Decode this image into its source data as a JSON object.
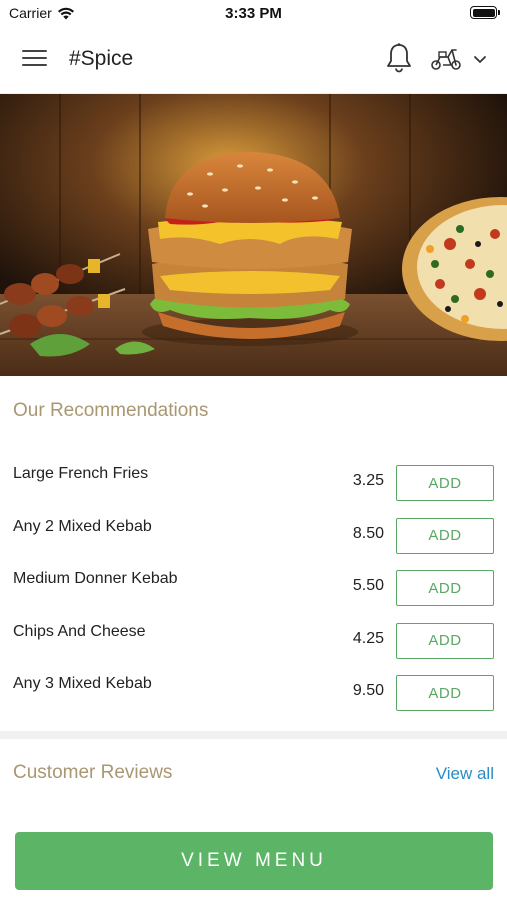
{
  "status_bar": {
    "carrier": "Carrier",
    "time": "3:33 PM"
  },
  "header": {
    "title": "#Spice",
    "icons": [
      "menu-icon",
      "bell-icon",
      "scooter-icon",
      "chevron-down-icon"
    ]
  },
  "hero": {
    "image": "burger-kebab-pizza-banner"
  },
  "recommendations": {
    "title": "Our Recommendations",
    "items": [
      {
        "name": "Large French Fries",
        "price": "3.25",
        "button": "ADD"
      },
      {
        "name": "Any 2 Mixed Kebab",
        "price": "8.50",
        "button": "ADD"
      },
      {
        "name": "Medium Donner Kebab",
        "price": "5.50",
        "button": "ADD"
      },
      {
        "name": "Chips And Cheese",
        "price": "4.25",
        "button": "ADD"
      },
      {
        "name": "Any 3 Mixed Kebab",
        "price": "9.50",
        "button": "ADD"
      }
    ]
  },
  "reviews": {
    "title": "Customer Reviews",
    "view_all": "View all"
  },
  "footer": {
    "view_menu": "VIEW MENU"
  },
  "colors": {
    "accent_green": "#5cb466",
    "section_title": "#a99773",
    "link_blue": "#2a8cc7"
  }
}
